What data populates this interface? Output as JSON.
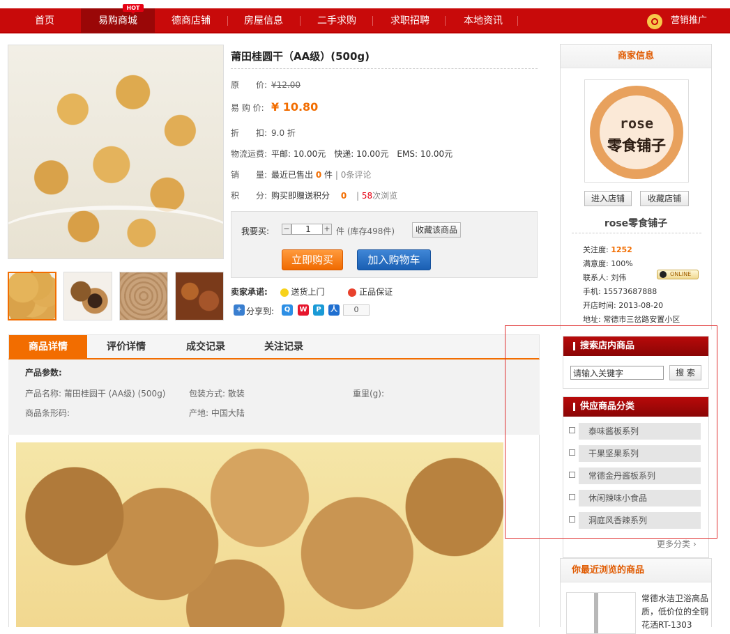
{
  "nav": {
    "items": [
      "首页",
      "易购商城",
      "德商店铺",
      "房屋信息",
      "二手求购",
      "求职招聘",
      "本地资讯"
    ],
    "hot_badge": "HOT",
    "promo_label": "营销推广"
  },
  "product": {
    "title": "莆田桂圆干（AA级）(500g)",
    "original_price_label": "原　　价:",
    "original_price": "¥12.00",
    "price_label": "易 购 价:",
    "price": "¥ 10.80",
    "discount_label": "折　　扣:",
    "discount": "9.0 折",
    "shipping_label": "物流运费:",
    "shipping": "平邮: 10.00元　快递: 10.00元　EMS: 10.00元",
    "sales_label": "销　　量:",
    "sales_prefix": "最近已售出",
    "sales_count": "0",
    "sales_unit": "件",
    "reviews": "0条评论",
    "points_label": "积　　分:",
    "points_text": "购买即赠送积分",
    "points_value": "0",
    "views_count": "58",
    "views_text": "次浏览"
  },
  "buy": {
    "want_label": "我要买:",
    "quantity": "1",
    "stock_text": "件 (库存498件)",
    "favorite_button": "收藏该商品",
    "buy_now": "立即购买",
    "add_to_cart": "加入购物车"
  },
  "promise": {
    "label": "卖家承诺:",
    "items": [
      "送货上门",
      "正品保证"
    ]
  },
  "share": {
    "label": "分享到:",
    "count": "0"
  },
  "tabs": [
    "商品详情",
    "评价详情",
    "成交记录",
    "关注记录"
  ],
  "params": {
    "heading": "产品参数:",
    "name": "产品名称: 莆田桂圆干 (AA级) (500g)",
    "packaging": "包装方式: 散装",
    "weight": "重里(g):",
    "barcode": "商品条形码:",
    "origin": "产地: 中国大陆"
  },
  "merchant": {
    "heading": "商家信息",
    "logo_line1": "rose",
    "logo_line2": "零食铺子",
    "enter_shop": "进入店铺",
    "favorite_shop": "收藏店铺",
    "shop_name": "rose零食铺子",
    "attention_label": "关注度:",
    "attention": "1252",
    "satisfaction": "满意度: 100%",
    "contact": "联系人: 刘伟",
    "online_badge": "ONLINE",
    "phone": "手机: 15573687888",
    "open_date": "开店时间: 2013-08-20",
    "address": "地址: 常德市三岔路安置小区"
  },
  "search": {
    "heading": "搜索店内商品",
    "placeholder": "请输入关键字",
    "button": "搜 索"
  },
  "categories": {
    "heading": "供应商品分类",
    "items": [
      "泰味酱板系列",
      "干果坚果系列",
      "常德金丹酱板系列",
      "休闲辣味小食品",
      "洞庭风香辣系列"
    ],
    "more": "更多分类 ›"
  },
  "recent": {
    "heading": "你最近浏览的商品",
    "item_text": "常德水洁卫浴高品质，低价位的全铜花洒RT-1303"
  }
}
